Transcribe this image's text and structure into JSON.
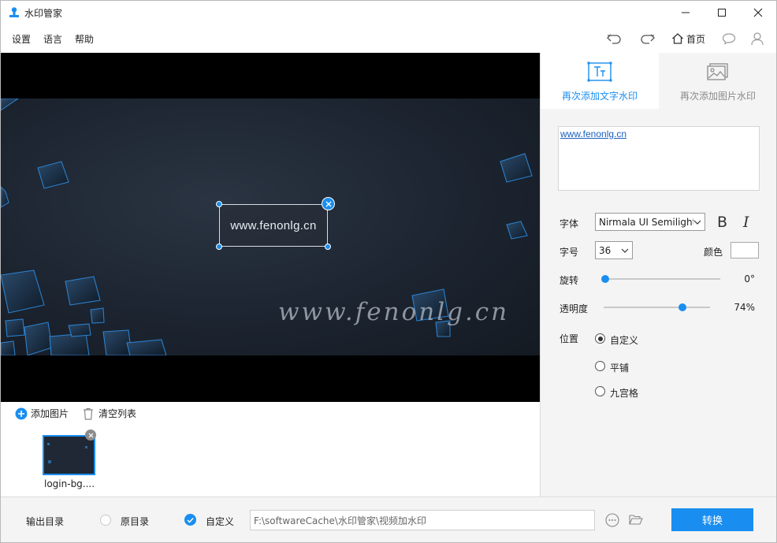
{
  "window": {
    "title": "水印管家",
    "controls": [
      "minimize-icon",
      "maximize-icon",
      "close-icon"
    ]
  },
  "menu": {
    "items": [
      "设置",
      "语言",
      "帮助"
    ]
  },
  "toolbar": {
    "undo": "undo-icon",
    "redo": "redo-icon",
    "home_label": "首页",
    "chat": "chat-icon",
    "user": "user-icon"
  },
  "preview": {
    "watermark_text": "www.fenonlg.cn",
    "background_watermark": "www.fenonlg.cn"
  },
  "panel": {
    "tabs": [
      {
        "label": "再次添加文字水印",
        "icon": "text-watermark-icon",
        "active": true
      },
      {
        "label": "再次添加图片水印",
        "icon": "image-watermark-icon",
        "active": false
      }
    ],
    "text_value": "www.fenonlg.cn",
    "font_label": "字体",
    "font_value": "Nirmala UI Semilight",
    "bold_icon": "B",
    "italic_icon": "I",
    "size_label": "字号",
    "size_value": "36",
    "color_label": "颜色",
    "color_value": "#ffffff",
    "rotation_label": "旋转",
    "rotation_value": "0°",
    "rotation_level": 0,
    "opacity_label": "透明度",
    "opacity_value": "74%",
    "opacity_level": 0.74,
    "position_label": "位置",
    "position_options": [
      {
        "label": "自定义",
        "selected": true
      },
      {
        "label": "平铺",
        "selected": false
      },
      {
        "label": "九宫格",
        "selected": false
      }
    ]
  },
  "strip": {
    "add_label": "添加图片",
    "clear_label": "清空列表",
    "thumb_name": "login-bg...."
  },
  "bottom": {
    "output_label": "输出目录",
    "option_original": "原目录",
    "option_custom": "自定义",
    "path": "F:\\softwareCache\\水印管家\\视频加水印",
    "convert_label": "转换"
  },
  "colors": {
    "accent": "#1a8ef0",
    "panel_bg": "#f4f4f4",
    "scene_bg": "#1c2430"
  }
}
